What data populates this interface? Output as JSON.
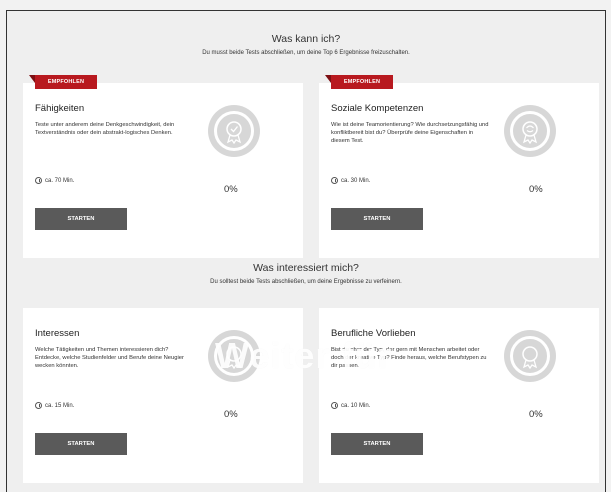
{
  "section1": {
    "title": "Was kann ich?",
    "subtitle": "Du musst beide Tests abschließen, um deine Top 6 Ergebnisse freizuschalten."
  },
  "section2": {
    "title": "Was interessiert mich?",
    "subtitle": "Du solltest beide Tests abschließen, um deine Ergebnisse zu verfeinern."
  },
  "cards": [
    {
      "ribbon": "EMPFOHLEN",
      "title": "Fähigkeiten",
      "description": "Teste unter anderem deine Denkgeschwindigkeit, dein Textverständnis oder dein abstrakt-logisches Denken.",
      "duration": "ca. 70 Min.",
      "progress": "0%",
      "button": "STARTEN"
    },
    {
      "ribbon": "EMPFOHLEN",
      "title": "Soziale Kompetenzen",
      "description": "Wie ist deine Teamorientierung? Wie durchsetzungsfähig und konfliktbereit bist du? Überprüfe deine Eigenschaften in diesem Test.",
      "duration": "ca. 30 Min.",
      "progress": "0%",
      "button": "STARTEN"
    },
    {
      "title": "Interessen",
      "description": "Welche Tätigkeiten und Themen interessieren dich? Entdecke, welche Studienfelder und Berufe deine Neugier wecken könnten.",
      "duration": "ca. 15 Min.",
      "progress": "0%",
      "button": "STARTEN"
    },
    {
      "title": "Berufliche Vorlieben",
      "description": "Bist du eher der Typ, der gern mit Menschen arbeitet oder doch der kreative Typ? Finde heraus, welche Berufstypen zu dir passen.",
      "duration": "ca. 10 Min.",
      "progress": "0%",
      "button": "STARTEN"
    }
  ],
  "overlay": "Weiter für"
}
